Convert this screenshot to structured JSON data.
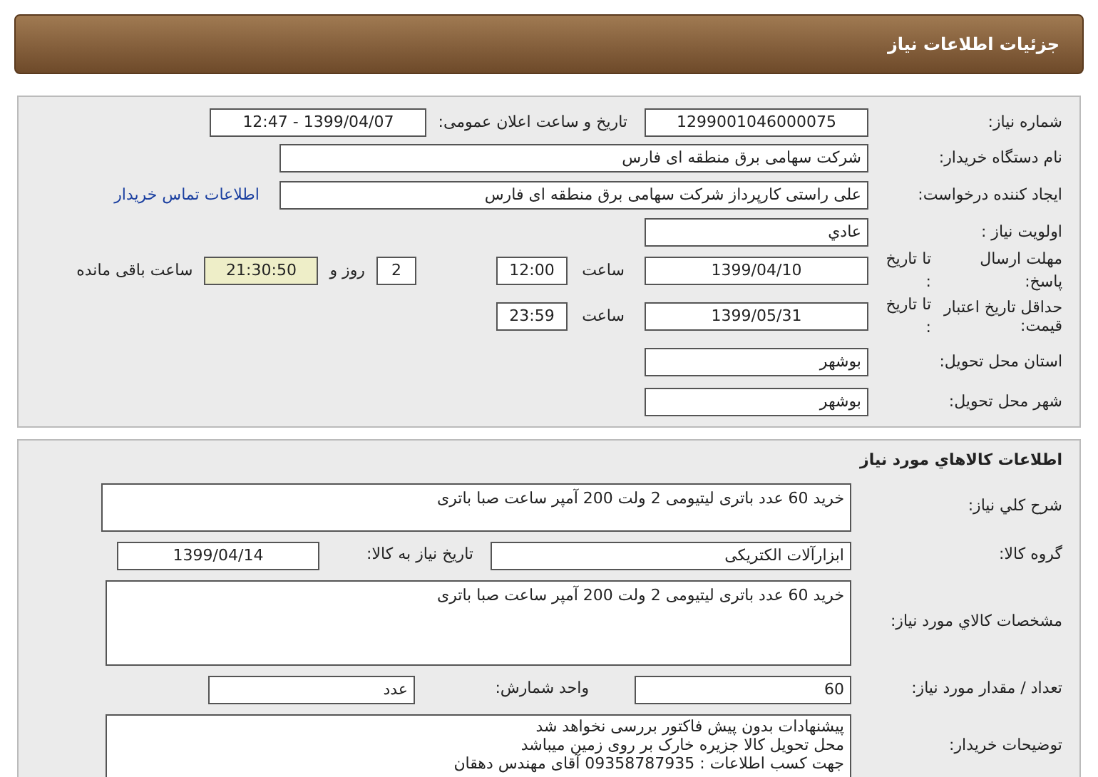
{
  "header": {
    "title": "جزئیات اطلاعات نیاز"
  },
  "details": {
    "need_number": {
      "label": "شماره نیاز:",
      "value": "1299001046000075"
    },
    "announce": {
      "label": "تاریخ و ساعت اعلان عمومی:",
      "value": "1399/04/07 - 12:47"
    },
    "buyer": {
      "label": "نام دستگاه خریدار:",
      "value": "شرکت سهامی برق منطقه ای فارس"
    },
    "creator": {
      "label": "ایجاد کننده درخواست:",
      "value": "علی راستی کارپرداز شرکت سهامی برق منطقه ای فارس",
      "link": "اطلاعات تماس خریدار"
    },
    "priority": {
      "label": "اولویت نیاز :",
      "value": "عادي"
    },
    "deadline": {
      "label": "مهلت ارسال پاسخ:",
      "to_label": "تا تاریخ :",
      "date": "1399/04/10",
      "time_label": "ساعت",
      "time": "12:00",
      "days": "2",
      "days_label": "روز و",
      "remaining": "21:30:50",
      "remaining_label": "ساعت باقی مانده"
    },
    "validity": {
      "label": "حداقل تاریخ اعتبار قیمت:",
      "to_label": "تا تاریخ :",
      "date": "1399/05/31",
      "time_label": "ساعت",
      "time": "23:59"
    },
    "province": {
      "label": "استان محل تحویل:",
      "value": "بوشهر"
    },
    "city": {
      "label": "شهر محل تحویل:",
      "value": "بوشهر"
    }
  },
  "goods": {
    "title": "اطلاعات کالاهاي مورد نياز",
    "summary": {
      "label": "شرح کلي نياز:",
      "value": "خرید 60 عدد باتری لیتیومی 2 ولت 200 آمپر ساعت صبا باتری"
    },
    "group": {
      "label": "گروه کالا:",
      "value": "ابزارآلات الکتریکی",
      "date_label": "تاریخ نیاز به کالا:",
      "date": "1399/04/14"
    },
    "specs": {
      "label": "مشخصات کالاي مورد نياز:",
      "value": "خرید 60 عدد باتری لیتیومی 2 ولت 200 آمپر ساعت صبا باتری"
    },
    "quantity": {
      "label": "تعداد / مقدار مورد نیاز:",
      "value": "60",
      "unit_label": "واحد شمارش:",
      "unit": "عدد"
    },
    "notes": {
      "label": "توضیحات خریدار:",
      "lines": [
        "پیشنهادات بدون پیش فاکتور بررسی نخواهد شد",
        "محل تحویل کالا جزیره خارک بر روی زمین میباشد",
        "جهت کسب اطلاعات : 09358787935 آقای مهندس دهقان"
      ]
    }
  }
}
